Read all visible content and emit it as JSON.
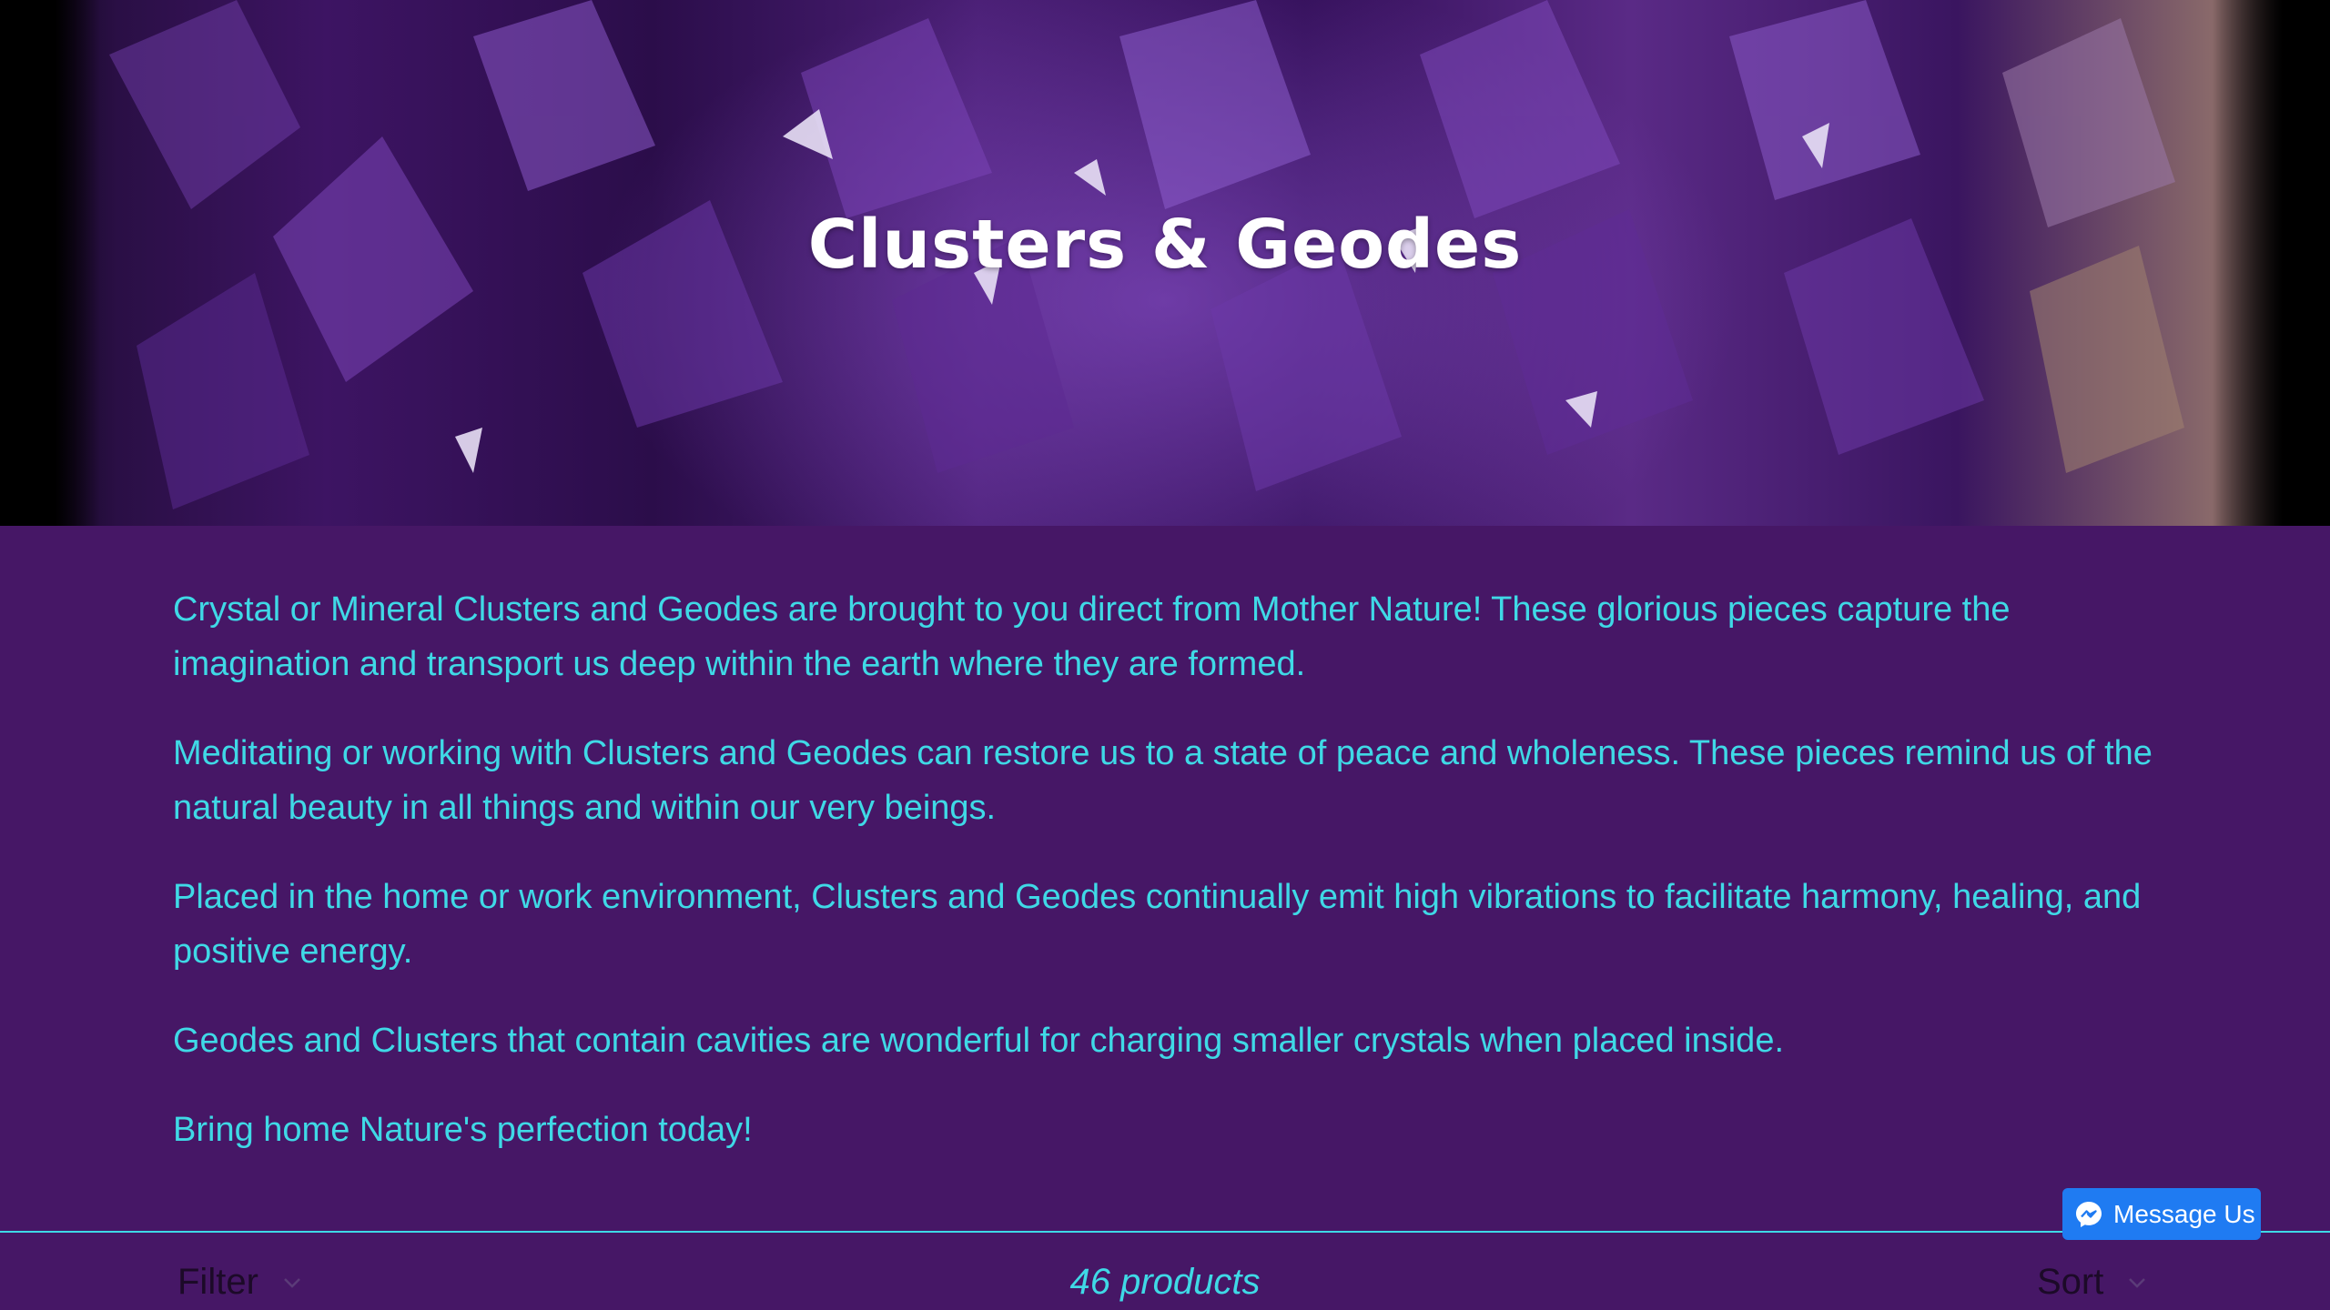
{
  "hero": {
    "title": "Clusters & Geodes",
    "image": "amethyst-cluster-photo"
  },
  "description": {
    "paragraphs": [
      "Crystal or Mineral Clusters and Geodes are brought to you direct from Mother Nature! These glorious pieces capture the imagination and transport us deep within the earth where they are formed.",
      "Meditating or working with Clusters and Geodes can restore us to a state of peace and wholeness. These pieces remind us of the natural beauty in all things and within our very beings.",
      "Placed in the home or work environment, Clusters and Geodes continually emit high vibrations to facilitate harmony, healing, and positive energy.",
      "Geodes and Clusters that contain cavities are wonderful for charging smaller crystals when placed inside.",
      "Bring home Nature's perfection today!"
    ]
  },
  "toolbar": {
    "filter_label": "Filter",
    "filter_icon": "chevron-down-icon",
    "product_count": "46 products",
    "sort_label": "Sort",
    "sort_icon": "chevron-down-icon"
  },
  "messenger": {
    "label": "Message Us",
    "icon": "messenger-icon"
  },
  "colors": {
    "page_background": "#461766",
    "text_accent": "#3fd9e6",
    "toolbar_text": "#1c0a28",
    "messenger_blue": "#1f7bf2"
  }
}
